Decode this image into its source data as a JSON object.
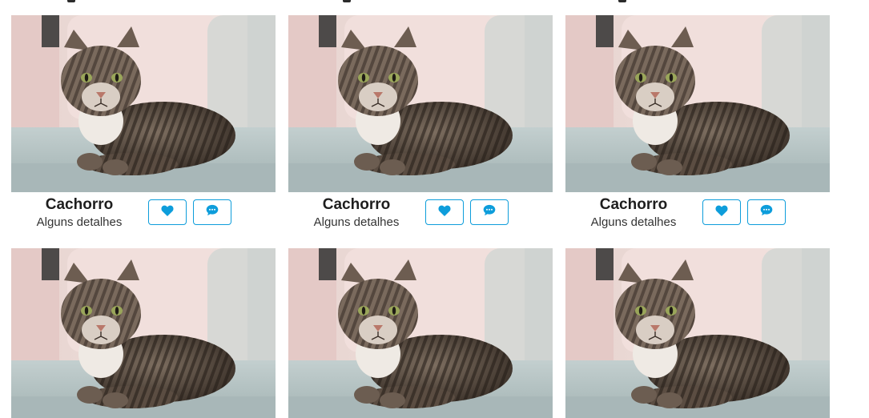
{
  "cards": [
    {
      "title": "Cachorro",
      "subtitle": "Alguns detalhes",
      "image_icon": "cat-photo",
      "like_icon": "heart-icon",
      "comment_icon": "comment-icon"
    },
    {
      "title": "Cachorro",
      "subtitle": "Alguns detalhes",
      "image_icon": "cat-photo",
      "like_icon": "heart-icon",
      "comment_icon": "comment-icon"
    },
    {
      "title": "Cachorro",
      "subtitle": "Alguns detalhes",
      "image_icon": "cat-photo",
      "like_icon": "heart-icon",
      "comment_icon": "comment-icon"
    },
    {
      "image_icon": "cat-photo"
    },
    {
      "image_icon": "cat-photo"
    },
    {
      "image_icon": "cat-photo"
    }
  ],
  "colors": {
    "accent": "#0d9ddb",
    "title": "#1e1e1e"
  }
}
